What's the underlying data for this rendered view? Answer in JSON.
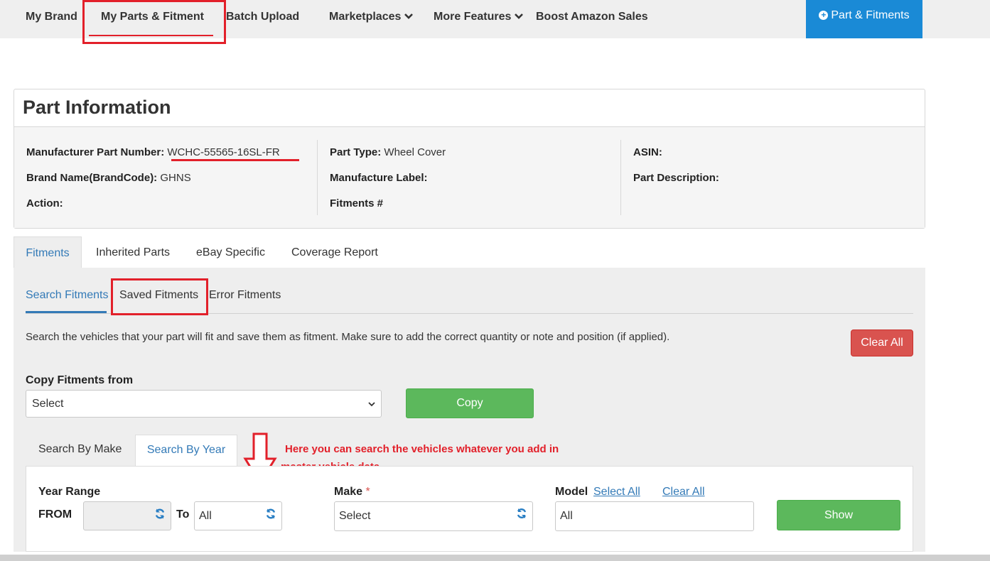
{
  "nav": {
    "my_brand": "My Brand",
    "my_parts": "My Parts & Fitment",
    "batch_upload": "Batch Upload",
    "marketplaces": "Marketplaces",
    "more_features": "More Features",
    "boost_amazon": "Boost Amazon Sales",
    "add_button": "Part & Fitments"
  },
  "part_info": {
    "title": "Part Information",
    "mpn_label": "Manufacturer Part Number:",
    "mpn_value": "WCHC-55565-16SL-FR",
    "brand_label": "Brand Name(BrandCode):",
    "brand_value": "GHNS",
    "action_label": "Action:",
    "part_type_label": "Part Type:",
    "part_type_value": "Wheel Cover",
    "manufacture_label_label": "Manufacture Label:",
    "fitments_label": "Fitments #",
    "asin_label": "ASIN:",
    "part_description_label": "Part Description:"
  },
  "tabs": [
    "Fitments",
    "Inherited Parts",
    "eBay Specific",
    "Coverage Report"
  ],
  "subtabs": [
    "Search Fitments",
    "Saved Fitments",
    "Error Fitments"
  ],
  "fitments": {
    "description": "Search the vehicles that your part will fit and save them as fitment. Make sure to add the correct quantity or note and position (if applied).",
    "clear_all": "Clear All",
    "copy_label": "Copy Fitments from",
    "copy_select": "Select",
    "copy_button": "Copy"
  },
  "search_tabs": [
    "Search By Make",
    "Search By Year"
  ],
  "annotation": {
    "line1": "Here you can search the vehicles whatever you add in",
    "line2": "master vehicle data"
  },
  "search": {
    "year_range_label": "Year Range",
    "from_label": "FROM",
    "to_label": "To",
    "from_value": "",
    "to_value": "All",
    "make_label": "Make",
    "make_required": "*",
    "make_value": "Select",
    "model_label": "Model",
    "select_all": "Select All",
    "clear_all": "Clear All",
    "model_value": "All",
    "show_button": "Show"
  },
  "colors": {
    "accent_blue": "#1a8ad6",
    "link_blue": "#337ab7",
    "danger_red": "#d9534f",
    "success_green": "#5cb85c",
    "annotation_red": "#e2202a"
  }
}
